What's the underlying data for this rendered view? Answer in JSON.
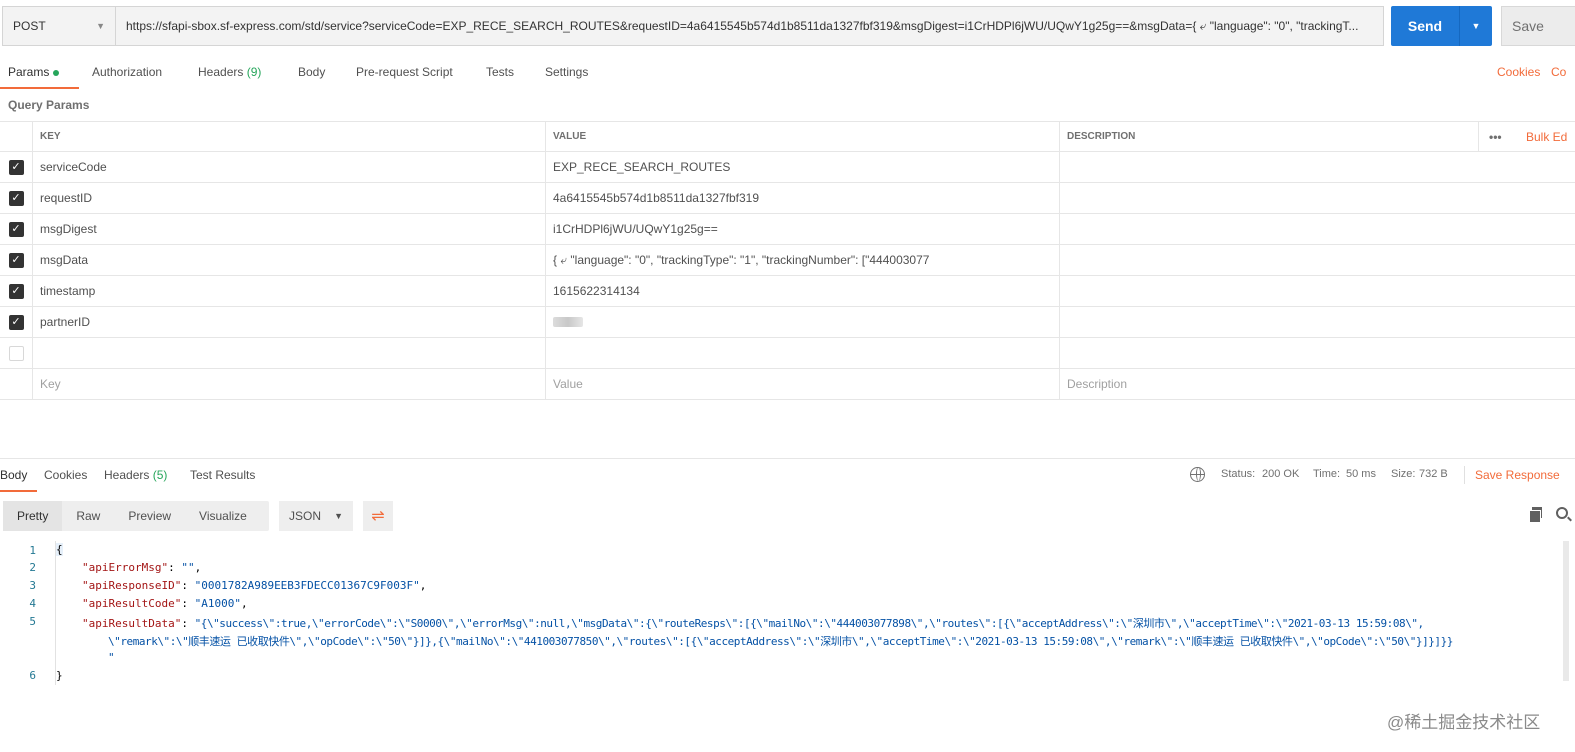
{
  "request": {
    "method": "POST",
    "url": "https://sfapi-sbox.sf-express.com/std/service?serviceCode=EXP_RECE_SEARCH_ROUTES&requestID=4a6415545b574d1b8511da1327fbf319&msgDigest=i1CrHDPl6jWU/UQwY1g25g==&msgData={ ⤶ \"language\": \"0\", \"trackingT...",
    "send_label": "Send",
    "save_label": "Save"
  },
  "tabs": {
    "params": "Params",
    "authorization": "Authorization",
    "headers": "Headers",
    "headers_count": "(9)",
    "body": "Body",
    "prerequest": "Pre-request Script",
    "tests": "Tests",
    "settings": "Settings",
    "cookies": "Cookies",
    "code": "Co"
  },
  "query_params": {
    "title": "Query Params",
    "columns": {
      "key": "KEY",
      "value": "VALUE",
      "description": "DESCRIPTION"
    },
    "bulk_edit": "Bulk Ed",
    "more": "•••",
    "rows": [
      {
        "key": "serviceCode",
        "value": "EXP_RECE_SEARCH_ROUTES"
      },
      {
        "key": "requestID",
        "value": "4a6415545b574d1b8511da1327fbf319"
      },
      {
        "key": "msgDigest",
        "value": "i1CrHDPl6jWU/UQwY1g25g=="
      },
      {
        "key": "msgData",
        "value": "{ ⤶ \"language\": \"0\", \"trackingType\": \"1\", \"trackingNumber\": [\"444003077"
      },
      {
        "key": "timestamp",
        "value": "1615622314134"
      },
      {
        "key": "partnerID",
        "value": ""
      }
    ],
    "placeholders": {
      "key": "Key",
      "value": "Value",
      "description": "Description"
    }
  },
  "response": {
    "tabs": {
      "body": "Body",
      "cookies": "Cookies",
      "headers": "Headers",
      "headers_count": "(5)",
      "test_results": "Test Results"
    },
    "status_label": "Status:",
    "status_value": "200 OK",
    "time_label": "Time:",
    "time_value": "50 ms",
    "size_label": "Size:",
    "size_value": "732 B",
    "save_response": "Save Response",
    "views": [
      "Pretty",
      "Raw",
      "Preview",
      "Visualize"
    ],
    "format": "JSON",
    "line_numbers": [
      "1",
      "2",
      "3",
      "4",
      "5",
      "6"
    ],
    "code": {
      "open": "{",
      "l2_key": "\"apiErrorMsg\"",
      "l2_val": "\"\"",
      "l3_key": "\"apiResponseID\"",
      "l3_val": "\"0001782A989EEB3FDECC01367C9F003F\"",
      "l4_key": "\"apiResultCode\"",
      "l4_val": "\"A1000\"",
      "l5_key": "\"apiResultData\"",
      "l5_val_a": "\"{\\\"success\\\":true,\\\"errorCode\\\":\\\"S0000\\\",\\\"errorMsg\\\":null,\\\"msgData\\\":{\\\"routeResps\\\":[{\\\"mailNo\\\":\\\"444003077898\\\",\\\"routes\\\":[{\\\"acceptAddress\\\":\\\"深圳市\\\",\\\"acceptTime\\\":\\\"2021-03-13 15:59:08\\\",",
      "l5_val_b": "\\\"remark\\\":\\\"顺丰速运 已收取快件\\\",\\\"opCode\\\":\\\"50\\\"}]},{\\\"mailNo\\\":\\\"441003077850\\\",\\\"routes\\\":[{\\\"acceptAddress\\\":\\\"深圳市\\\",\\\"acceptTime\\\":\\\"2021-03-13 15:59:08\\\",\\\"remark\\\":\\\"顺丰速运 已收取快件\\\",\\\"opCode\\\":\\\"50\\\"}]}]}}",
      "l5_val_c": "\"",
      "close": "}"
    }
  },
  "watermark": "@稀土掘金技术社区",
  "colors": {
    "accent": "#f26b3a",
    "send": "#1f79d7",
    "ok": "#26a65b"
  }
}
